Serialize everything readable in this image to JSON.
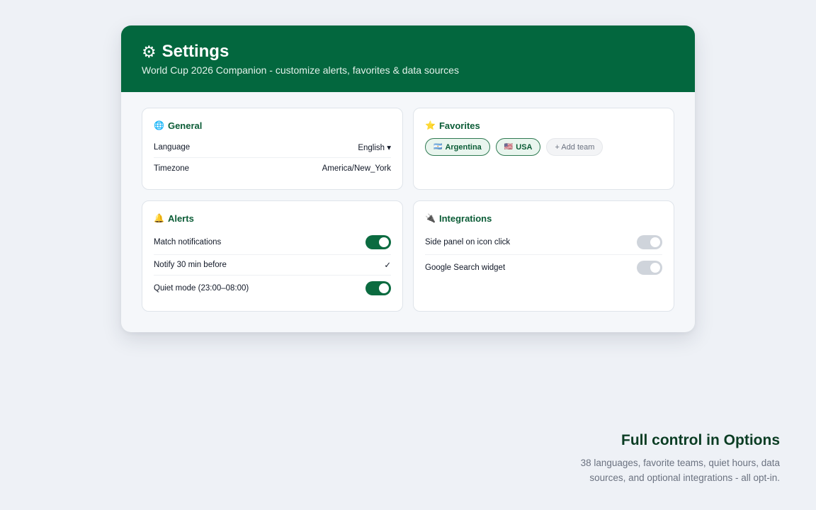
{
  "header": {
    "gear_icon": "⚙",
    "title": "Settings",
    "subtitle": "World Cup 2026 Companion - customize alerts, favorites & data sources"
  },
  "general": {
    "icon": "🌐",
    "title": "General",
    "language_label": "Language",
    "language_value": "English ▾",
    "timezone_label": "Timezone",
    "timezone_value": "America/New_York"
  },
  "favorites": {
    "icon": "⭐",
    "title": "Favorites",
    "teams": [
      {
        "flag": "🇦🇷",
        "name": "Argentina"
      },
      {
        "flag": "🇺🇸",
        "name": "USA"
      }
    ],
    "add_label": "+ Add team"
  },
  "alerts": {
    "icon": "🔔",
    "title": "Alerts",
    "match_notifications_label": "Match notifications",
    "match_notifications_on": true,
    "notify_label": "Notify 30 min before",
    "notify_check": "✓",
    "quiet_mode_label": "Quiet mode (23:00–08:00)",
    "quiet_mode_on": true
  },
  "integrations": {
    "icon": "🔌",
    "title": "Integrations",
    "side_panel_label": "Side panel on icon click",
    "side_panel_on": false,
    "google_widget_label": "Google Search widget",
    "google_widget_on": false
  },
  "promo": {
    "title": "Full control in Options",
    "text": "38 languages, favorite teams, quiet hours, data sources, and optional integrations - all opt-in."
  },
  "colors": {
    "brand_green": "#03673e",
    "toggle_on": "#0b6b40",
    "toggle_off": "#cfd4db"
  }
}
